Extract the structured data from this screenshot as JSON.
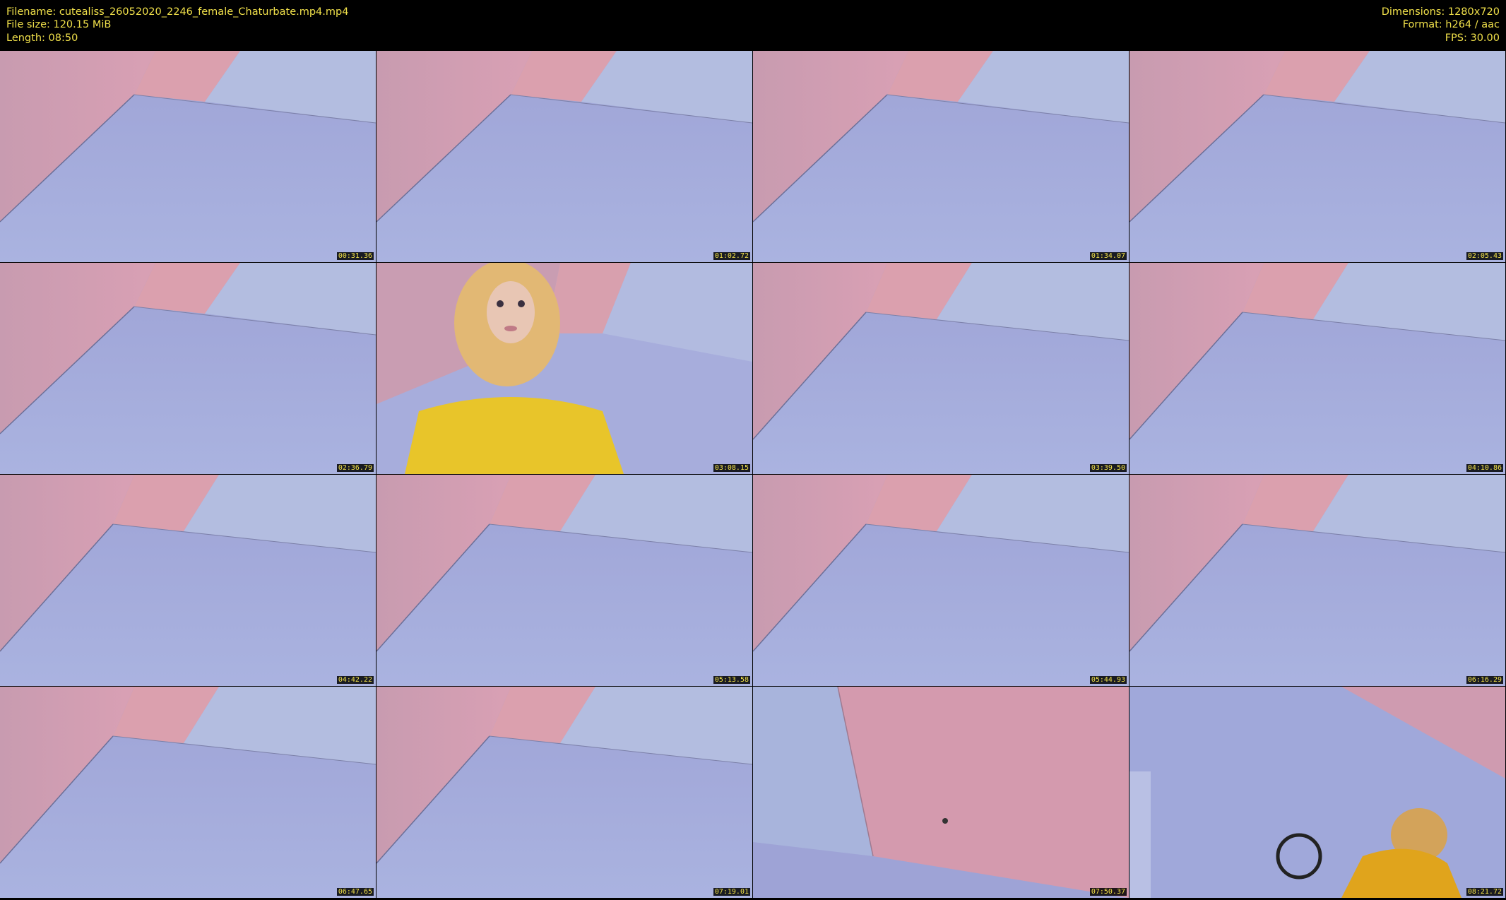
{
  "header": {
    "filename": "Filename: cutealiss_26052020_2246_female_Chaturbate.mp4.mp4",
    "filesize": "File size: 120.15 MiB",
    "length": "Length: 08:50",
    "dimensions": "Dimensions: 1280x720",
    "format": "Format: h264 / aac",
    "fps": "FPS: 30.00"
  },
  "colors": {
    "text": "#f0e04a",
    "wall_pink": "#d8a3b8",
    "wall_blue": "#a9b6dc",
    "floor": "#9fa6da",
    "shirt_yellow": "#e8c52a"
  },
  "thumbnails": [
    {
      "timestamp": "00:31.36",
      "scene": "room"
    },
    {
      "timestamp": "01:02.72",
      "scene": "room"
    },
    {
      "timestamp": "01:34.07",
      "scene": "room"
    },
    {
      "timestamp": "02:05.43",
      "scene": "room"
    },
    {
      "timestamp": "02:36.79",
      "scene": "room"
    },
    {
      "timestamp": "03:08.15",
      "scene": "person-yellow-shirt"
    },
    {
      "timestamp": "03:39.50",
      "scene": "room"
    },
    {
      "timestamp": "04:10.86",
      "scene": "room"
    },
    {
      "timestamp": "04:42.22",
      "scene": "room"
    },
    {
      "timestamp": "05:13.58",
      "scene": "room"
    },
    {
      "timestamp": "05:44.93",
      "scene": "room"
    },
    {
      "timestamp": "06:16.29",
      "scene": "room"
    },
    {
      "timestamp": "06:47.65",
      "scene": "room"
    },
    {
      "timestamp": "07:19.01",
      "scene": "room"
    },
    {
      "timestamp": "07:50.37",
      "scene": "wall-closeup"
    },
    {
      "timestamp": "08:21.72",
      "scene": "person-corner"
    }
  ]
}
